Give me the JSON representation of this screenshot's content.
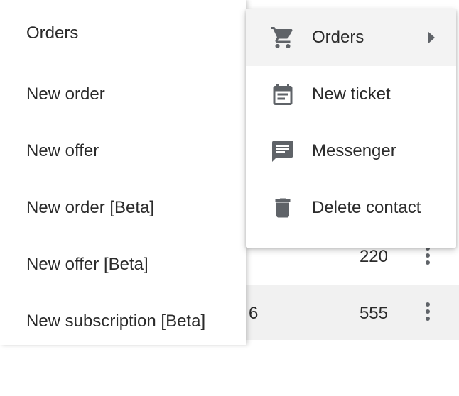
{
  "submenu": {
    "items": [
      {
        "label": "Orders"
      },
      {
        "label": "New order"
      },
      {
        "label": "New offer"
      },
      {
        "label": "New order [Beta]"
      },
      {
        "label": "New offer [Beta]"
      },
      {
        "label": "New subscription [Beta]"
      }
    ]
  },
  "context_menu": {
    "items": [
      {
        "label": "Orders",
        "icon": "cart-icon",
        "has_submenu": true
      },
      {
        "label": "New ticket",
        "icon": "calendar-icon"
      },
      {
        "label": "Messenger",
        "icon": "message-icon"
      },
      {
        "label": "Delete contact",
        "icon": "trash-icon"
      }
    ]
  },
  "table": {
    "rows": [
      {
        "left": "",
        "value": "220"
      },
      {
        "left": "6",
        "value": "555"
      }
    ]
  },
  "colors": {
    "icon": "#5f6368",
    "text": "#2b2b2b",
    "hover": "#f3f3f3"
  }
}
